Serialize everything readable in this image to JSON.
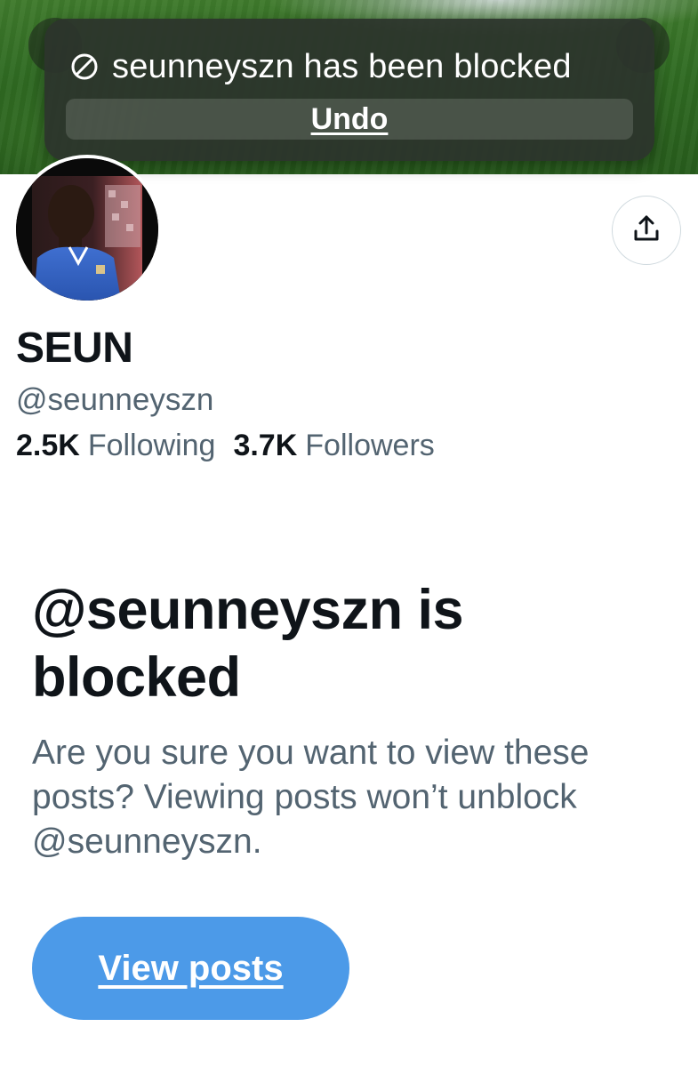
{
  "toast": {
    "icon": "blocked-circle-icon",
    "message": "seunneyszn has been blocked",
    "undo_label": "Undo"
  },
  "profile": {
    "display_name": "SEUN",
    "handle": "@seunneyszn",
    "following_count": "2.5K",
    "following_label": "Following",
    "followers_count": "3.7K",
    "followers_label": "Followers"
  },
  "share_button": {
    "icon": "share-upload-icon"
  },
  "blocked": {
    "title": "@seunneyszn is blocked",
    "description": "Are you sure you want to view these posts? Viewing posts won’t unblock @seunneyszn.",
    "button_label": "View posts"
  },
  "colors": {
    "primary_text": "#0f1419",
    "secondary_text": "#536471",
    "button_blue": "#4c9ae8",
    "toast_bg": "#2c342c"
  }
}
